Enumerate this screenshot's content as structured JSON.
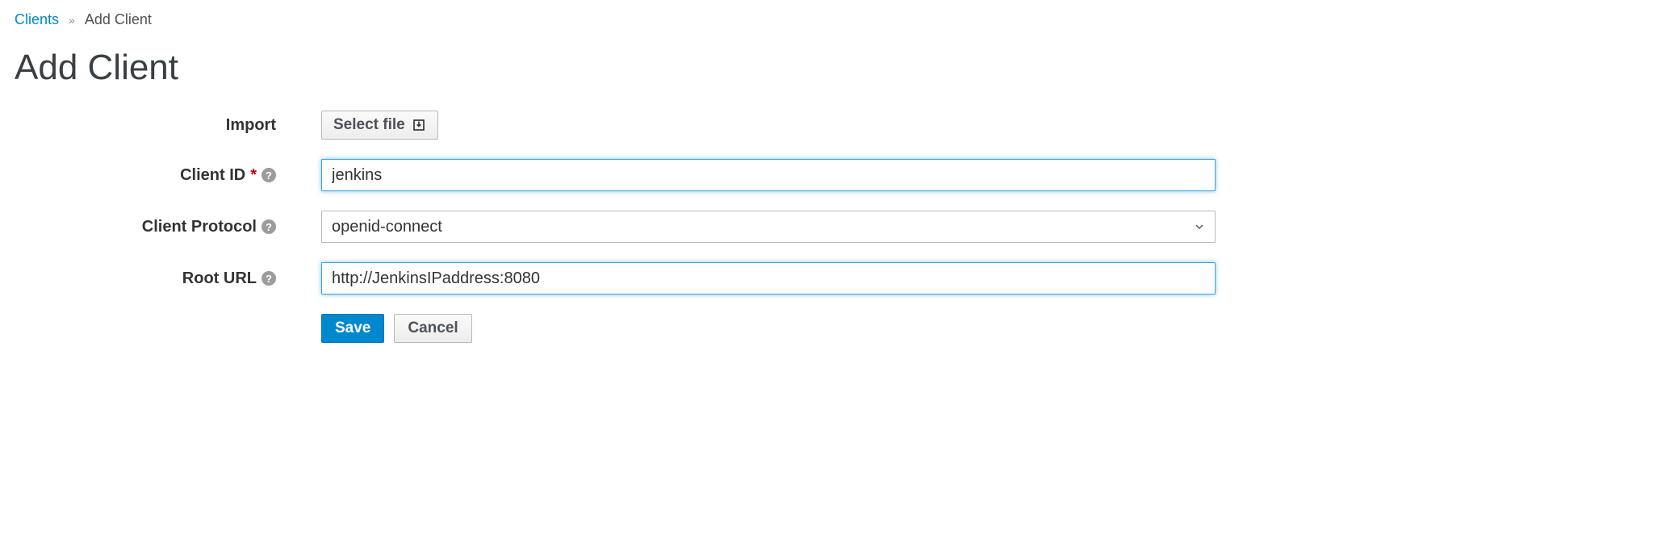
{
  "breadcrumb": {
    "parent": "Clients",
    "separator": "»",
    "current": "Add Client"
  },
  "title": "Add Client",
  "form": {
    "import": {
      "label": "Import",
      "button": "Select file"
    },
    "client_id": {
      "label": "Client ID",
      "required_marker": "*",
      "value": "jenkins"
    },
    "client_protocol": {
      "label": "Client Protocol",
      "selected": "openid-connect"
    },
    "root_url": {
      "label": "Root URL",
      "value": "http://JenkinsIPaddress:8080"
    }
  },
  "actions": {
    "save": "Save",
    "cancel": "Cancel"
  },
  "icons": {
    "help_glyph": "?"
  }
}
